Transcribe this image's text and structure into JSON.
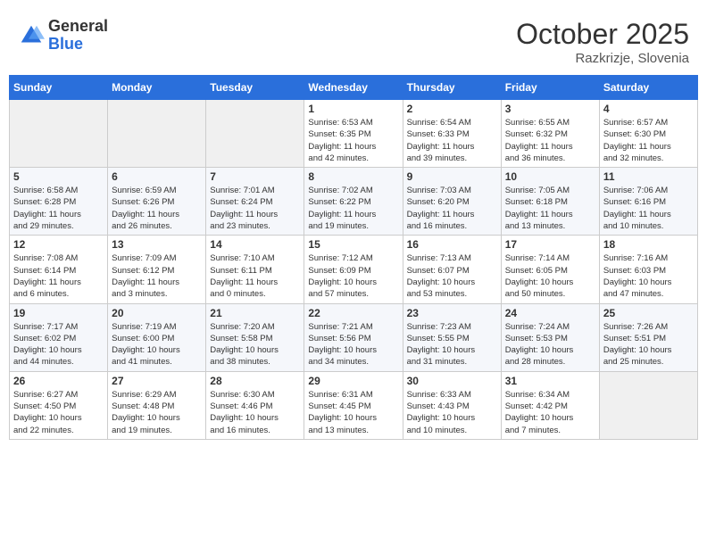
{
  "logo": {
    "general": "General",
    "blue": "Blue"
  },
  "header": {
    "month": "October 2025",
    "location": "Razkrizje, Slovenia"
  },
  "days_of_week": [
    "Sunday",
    "Monday",
    "Tuesday",
    "Wednesday",
    "Thursday",
    "Friday",
    "Saturday"
  ],
  "weeks": [
    [
      {
        "day": "",
        "info": ""
      },
      {
        "day": "",
        "info": ""
      },
      {
        "day": "",
        "info": ""
      },
      {
        "day": "1",
        "info": "Sunrise: 6:53 AM\nSunset: 6:35 PM\nDaylight: 11 hours\nand 42 minutes."
      },
      {
        "day": "2",
        "info": "Sunrise: 6:54 AM\nSunset: 6:33 PM\nDaylight: 11 hours\nand 39 minutes."
      },
      {
        "day": "3",
        "info": "Sunrise: 6:55 AM\nSunset: 6:32 PM\nDaylight: 11 hours\nand 36 minutes."
      },
      {
        "day": "4",
        "info": "Sunrise: 6:57 AM\nSunset: 6:30 PM\nDaylight: 11 hours\nand 32 minutes."
      }
    ],
    [
      {
        "day": "5",
        "info": "Sunrise: 6:58 AM\nSunset: 6:28 PM\nDaylight: 11 hours\nand 29 minutes."
      },
      {
        "day": "6",
        "info": "Sunrise: 6:59 AM\nSunset: 6:26 PM\nDaylight: 11 hours\nand 26 minutes."
      },
      {
        "day": "7",
        "info": "Sunrise: 7:01 AM\nSunset: 6:24 PM\nDaylight: 11 hours\nand 23 minutes."
      },
      {
        "day": "8",
        "info": "Sunrise: 7:02 AM\nSunset: 6:22 PM\nDaylight: 11 hours\nand 19 minutes."
      },
      {
        "day": "9",
        "info": "Sunrise: 7:03 AM\nSunset: 6:20 PM\nDaylight: 11 hours\nand 16 minutes."
      },
      {
        "day": "10",
        "info": "Sunrise: 7:05 AM\nSunset: 6:18 PM\nDaylight: 11 hours\nand 13 minutes."
      },
      {
        "day": "11",
        "info": "Sunrise: 7:06 AM\nSunset: 6:16 PM\nDaylight: 11 hours\nand 10 minutes."
      }
    ],
    [
      {
        "day": "12",
        "info": "Sunrise: 7:08 AM\nSunset: 6:14 PM\nDaylight: 11 hours\nand 6 minutes."
      },
      {
        "day": "13",
        "info": "Sunrise: 7:09 AM\nSunset: 6:12 PM\nDaylight: 11 hours\nand 3 minutes."
      },
      {
        "day": "14",
        "info": "Sunrise: 7:10 AM\nSunset: 6:11 PM\nDaylight: 11 hours\nand 0 minutes."
      },
      {
        "day": "15",
        "info": "Sunrise: 7:12 AM\nSunset: 6:09 PM\nDaylight: 10 hours\nand 57 minutes."
      },
      {
        "day": "16",
        "info": "Sunrise: 7:13 AM\nSunset: 6:07 PM\nDaylight: 10 hours\nand 53 minutes."
      },
      {
        "day": "17",
        "info": "Sunrise: 7:14 AM\nSunset: 6:05 PM\nDaylight: 10 hours\nand 50 minutes."
      },
      {
        "day": "18",
        "info": "Sunrise: 7:16 AM\nSunset: 6:03 PM\nDaylight: 10 hours\nand 47 minutes."
      }
    ],
    [
      {
        "day": "19",
        "info": "Sunrise: 7:17 AM\nSunset: 6:02 PM\nDaylight: 10 hours\nand 44 minutes."
      },
      {
        "day": "20",
        "info": "Sunrise: 7:19 AM\nSunset: 6:00 PM\nDaylight: 10 hours\nand 41 minutes."
      },
      {
        "day": "21",
        "info": "Sunrise: 7:20 AM\nSunset: 5:58 PM\nDaylight: 10 hours\nand 38 minutes."
      },
      {
        "day": "22",
        "info": "Sunrise: 7:21 AM\nSunset: 5:56 PM\nDaylight: 10 hours\nand 34 minutes."
      },
      {
        "day": "23",
        "info": "Sunrise: 7:23 AM\nSunset: 5:55 PM\nDaylight: 10 hours\nand 31 minutes."
      },
      {
        "day": "24",
        "info": "Sunrise: 7:24 AM\nSunset: 5:53 PM\nDaylight: 10 hours\nand 28 minutes."
      },
      {
        "day": "25",
        "info": "Sunrise: 7:26 AM\nSunset: 5:51 PM\nDaylight: 10 hours\nand 25 minutes."
      }
    ],
    [
      {
        "day": "26",
        "info": "Sunrise: 6:27 AM\nSunset: 4:50 PM\nDaylight: 10 hours\nand 22 minutes."
      },
      {
        "day": "27",
        "info": "Sunrise: 6:29 AM\nSunset: 4:48 PM\nDaylight: 10 hours\nand 19 minutes."
      },
      {
        "day": "28",
        "info": "Sunrise: 6:30 AM\nSunset: 4:46 PM\nDaylight: 10 hours\nand 16 minutes."
      },
      {
        "day": "29",
        "info": "Sunrise: 6:31 AM\nSunset: 4:45 PM\nDaylight: 10 hours\nand 13 minutes."
      },
      {
        "day": "30",
        "info": "Sunrise: 6:33 AM\nSunset: 4:43 PM\nDaylight: 10 hours\nand 10 minutes."
      },
      {
        "day": "31",
        "info": "Sunrise: 6:34 AM\nSunset: 4:42 PM\nDaylight: 10 hours\nand 7 minutes."
      },
      {
        "day": "",
        "info": ""
      }
    ]
  ]
}
